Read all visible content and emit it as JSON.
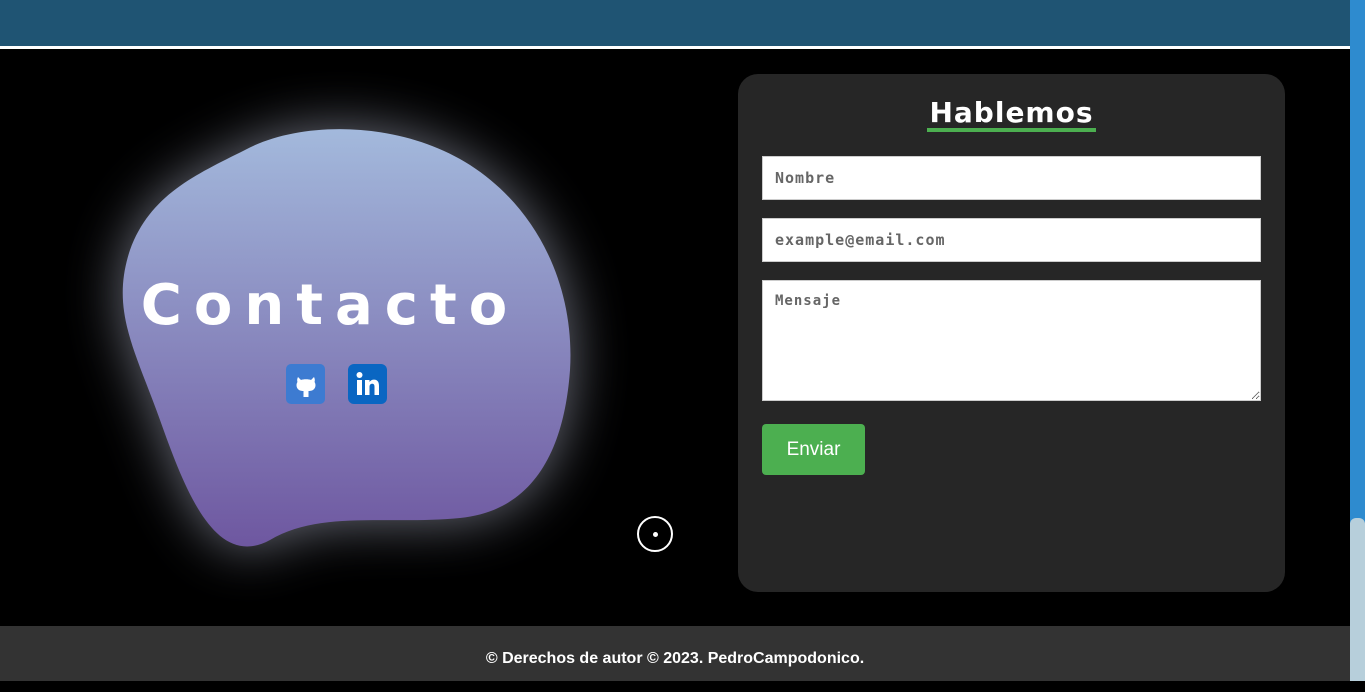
{
  "hero": {
    "title": "Contacto",
    "social": [
      {
        "icon": "github-icon",
        "color": "#3d7bd1"
      },
      {
        "icon": "linkedin-icon",
        "color": "#0a66c2"
      }
    ]
  },
  "form": {
    "title": "Hablemos",
    "name_placeholder": "Nombre",
    "email_placeholder": "example@email.com",
    "message_placeholder": "Mensaje",
    "submit_label": "Enviar",
    "accent": "#4caf50"
  },
  "footer": {
    "text": "© Derechos de autor © 2023. PedroCampodonico."
  },
  "colors": {
    "header": "#1f5473",
    "card": "#262626",
    "footer": "#333333",
    "blob_top": "#a3b9dc",
    "blob_bottom": "#6e57a0"
  }
}
